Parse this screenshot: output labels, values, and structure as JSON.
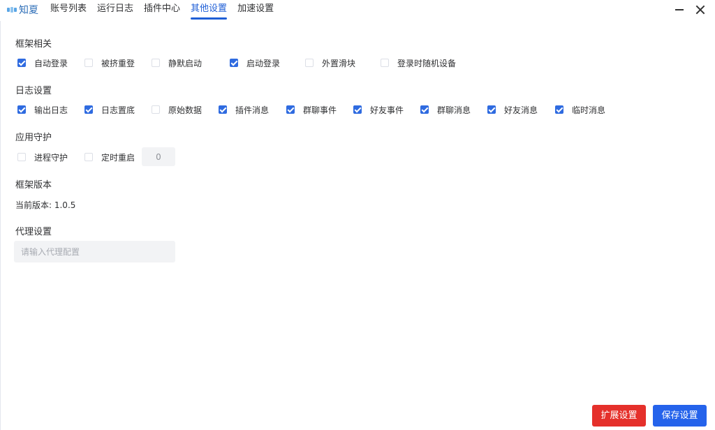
{
  "app": {
    "logo_text": "知夏"
  },
  "tabs": [
    {
      "label": "账号列表"
    },
    {
      "label": "运行日志"
    },
    {
      "label": "插件中心"
    },
    {
      "label": "其他设置",
      "active": true
    },
    {
      "label": "加速设置"
    }
  ],
  "framework": {
    "title": "框架相关",
    "options": [
      {
        "label": "自动登录",
        "checked": true
      },
      {
        "label": "被挤重登",
        "checked": false
      },
      {
        "label": "静默启动",
        "checked": false
      },
      {
        "label": "启动登录",
        "checked": true
      },
      {
        "label": "外置滑块",
        "checked": false
      },
      {
        "label": "登录时随机设备",
        "checked": false
      }
    ]
  },
  "log": {
    "title": "日志设置",
    "options": [
      {
        "label": "输出日志",
        "checked": true
      },
      {
        "label": "日志置底",
        "checked": true
      },
      {
        "label": "原始数据",
        "checked": false
      },
      {
        "label": "插件消息",
        "checked": true
      },
      {
        "label": "群聊事件",
        "checked": true
      },
      {
        "label": "好友事件",
        "checked": true
      },
      {
        "label": "群聊消息",
        "checked": true
      },
      {
        "label": "好友消息",
        "checked": true
      },
      {
        "label": "临时消息",
        "checked": true
      }
    ]
  },
  "guard": {
    "title": "应用守护",
    "options": [
      {
        "label": "进程守护",
        "checked": false
      },
      {
        "label": "定时重启",
        "checked": false
      }
    ],
    "restart_value": "0"
  },
  "version": {
    "title": "框架版本",
    "text": "当前版本: 1.0.5"
  },
  "proxy": {
    "title": "代理设置",
    "placeholder": "请输入代理配置",
    "value": ""
  },
  "buttons": {
    "extend": "扩展设置",
    "save": "保存设置"
  },
  "colors": {
    "accent": "#2f6be0",
    "danger": "#e5302b",
    "primary": "#2563eb"
  }
}
